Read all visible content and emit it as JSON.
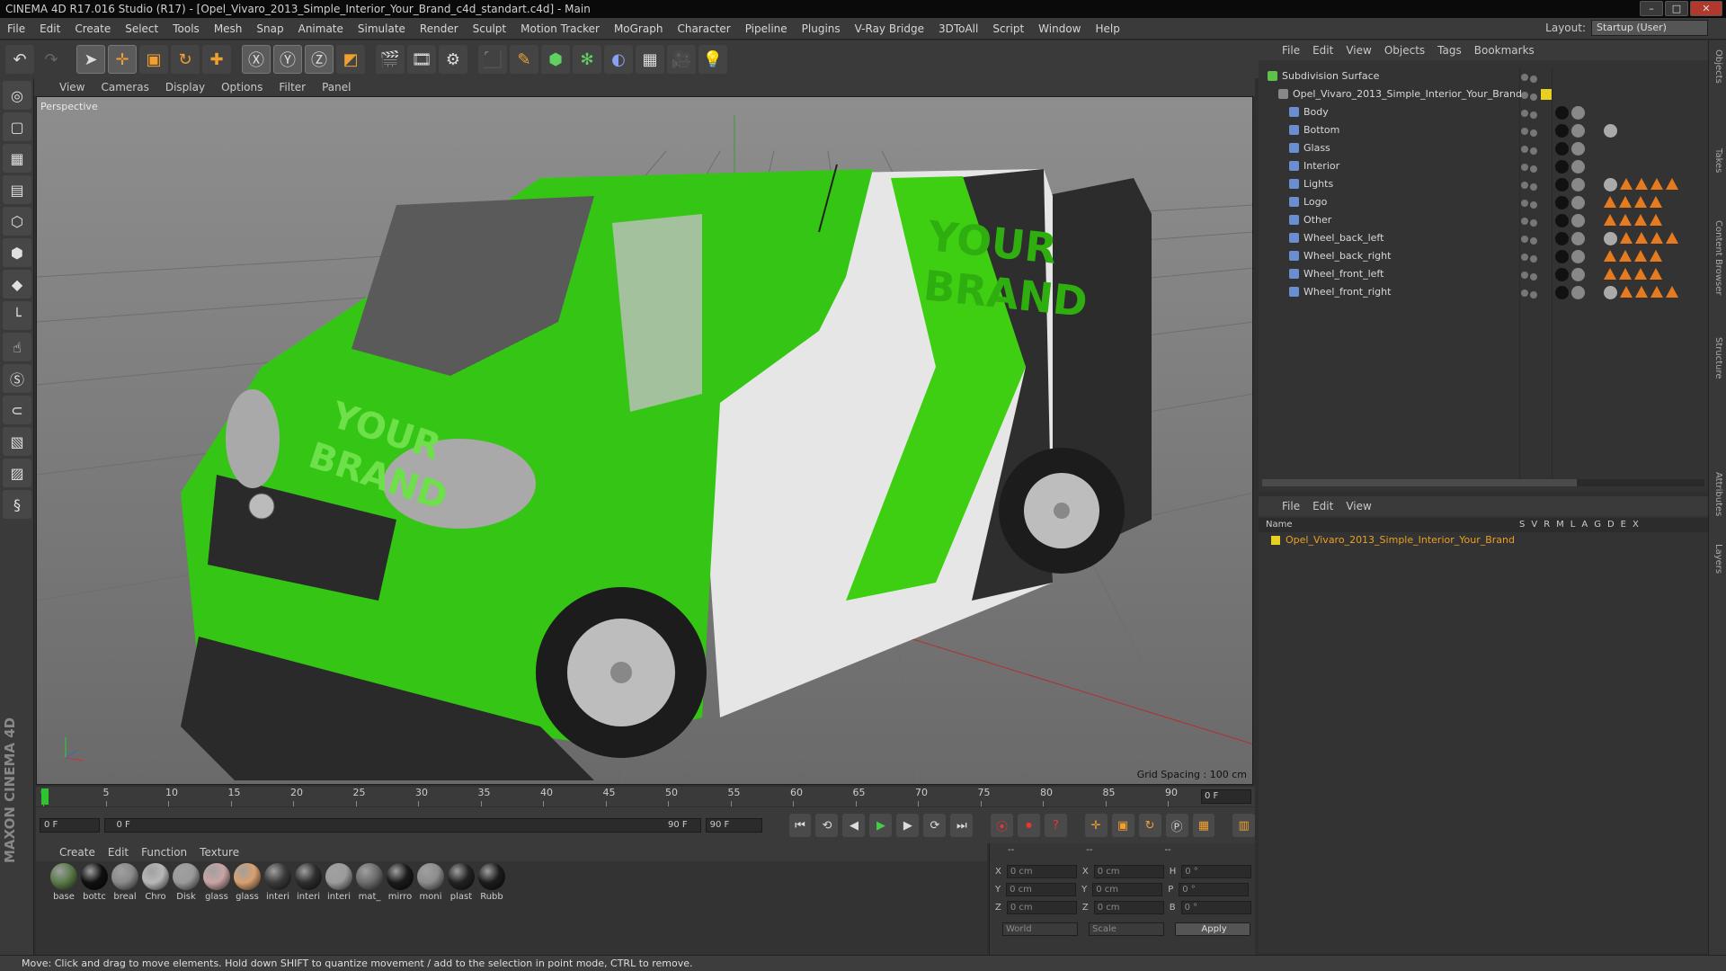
{
  "title": "CINEMA 4D R17.016 Studio (R17) - [Opel_Vivaro_2013_Simple_Interior_Your_Brand_c4d_standart.c4d] - Main",
  "menu": [
    "File",
    "Edit",
    "Create",
    "Select",
    "Tools",
    "Mesh",
    "Snap",
    "Animate",
    "Simulate",
    "Render",
    "Sculpt",
    "Motion Tracker",
    "MoGraph",
    "Character",
    "Pipeline",
    "Plugins",
    "V-Ray Bridge",
    "3DToAll",
    "Script",
    "Window",
    "Help"
  ],
  "layout_label": "Layout:",
  "layout_value": "Startup (User)",
  "viewport": {
    "menu": [
      "View",
      "Cameras",
      "Display",
      "Options",
      "Filter",
      "Panel"
    ],
    "camera_label": "Perspective",
    "grid_spacing": "Grid Spacing : 100 cm",
    "brand_text_1": "YOUR",
    "brand_text_2": "BRAND"
  },
  "timeline": {
    "ticks": [
      "0",
      "5",
      "10",
      "15",
      "20",
      "25",
      "30",
      "35",
      "40",
      "45",
      "50",
      "55",
      "60",
      "65",
      "70",
      "75",
      "80",
      "85",
      "90"
    ],
    "current_frame": "0 F"
  },
  "transport": {
    "start_field": "0 F",
    "range_start": "0 F",
    "range_end": "90 F",
    "end_field": "90 F"
  },
  "material_menu": [
    "Create",
    "Edit",
    "Function",
    "Texture"
  ],
  "materials": [
    {
      "name": "base",
      "color": "#5a7a4a"
    },
    {
      "name": "bottc",
      "color": "#101010"
    },
    {
      "name": "breal",
      "color": "#8a8a8a"
    },
    {
      "name": "Chro",
      "color": "#b8b8b8"
    },
    {
      "name": "Disk",
      "color": "#9a9a9a"
    },
    {
      "name": "glass",
      "color": "#c9a4a4"
    },
    {
      "name": "glass",
      "color": "#d9a070"
    },
    {
      "name": "interi",
      "color": "#3a3a3a"
    },
    {
      "name": "interi",
      "color": "#2d2d2d"
    },
    {
      "name": "interi",
      "color": "#9c9c9c"
    },
    {
      "name": "mat_",
      "color": "#6c6c6c"
    },
    {
      "name": "mirro",
      "color": "#1a1a1a"
    },
    {
      "name": "moni",
      "color": "#8c8c8c"
    },
    {
      "name": "plast",
      "color": "#222222"
    },
    {
      "name": "Rubb",
      "color": "#1c1c1c"
    }
  ],
  "coords": {
    "header": [
      "--",
      "--",
      "--"
    ],
    "rows": [
      {
        "a": "X",
        "av": "0 cm",
        "b": "X",
        "bv": "0 cm",
        "c": "H",
        "cv": "0 °"
      },
      {
        "a": "Y",
        "av": "0 cm",
        "b": "Y",
        "bv": "0 cm",
        "c": "P",
        "cv": "0 °"
      },
      {
        "a": "Z",
        "av": "0 cm",
        "b": "Z",
        "bv": "0 cm",
        "c": "B",
        "cv": "0 °"
      }
    ],
    "world": "World",
    "scale": "Scale",
    "apply": "Apply"
  },
  "objects_menu": [
    "File",
    "Edit",
    "View",
    "Objects",
    "Tags",
    "Bookmarks"
  ],
  "objects": [
    {
      "name": "Subdivision Surface",
      "indent": 0
    },
    {
      "name": "Opel_Vivaro_2013_Simple_Interior_Your_Brand",
      "indent": 1
    },
    {
      "name": "Body",
      "indent": 2
    },
    {
      "name": "Bottom",
      "indent": 2
    },
    {
      "name": "Glass",
      "indent": 2
    },
    {
      "name": "Interior",
      "indent": 2
    },
    {
      "name": "Lights",
      "indent": 2
    },
    {
      "name": "Logo",
      "indent": 2
    },
    {
      "name": "Other",
      "indent": 2
    },
    {
      "name": "Wheel_back_left",
      "indent": 2
    },
    {
      "name": "Wheel_back_right",
      "indent": 2
    },
    {
      "name": "Wheel_front_left",
      "indent": 2
    },
    {
      "name": "Wheel_front_right",
      "indent": 2
    }
  ],
  "layers_menu": [
    "File",
    "Edit",
    "View"
  ],
  "layers_header": {
    "name": "Name",
    "cols": [
      "S",
      "V",
      "R",
      "M",
      "L",
      "A",
      "G",
      "D",
      "E",
      "X"
    ]
  },
  "layer_row": "Opel_Vivaro_2013_Simple_Interior_Your_Brand",
  "right_tabs": [
    "Objects",
    "Takes",
    "Content Browser",
    "Structure",
    "Attributes",
    "Layers"
  ],
  "maxon": "MAXON CINEMA 4D",
  "status": "Move: Click and drag to move elements. Hold down SHIFT to quantize movement / add to the selection in point mode, CTRL to remove."
}
